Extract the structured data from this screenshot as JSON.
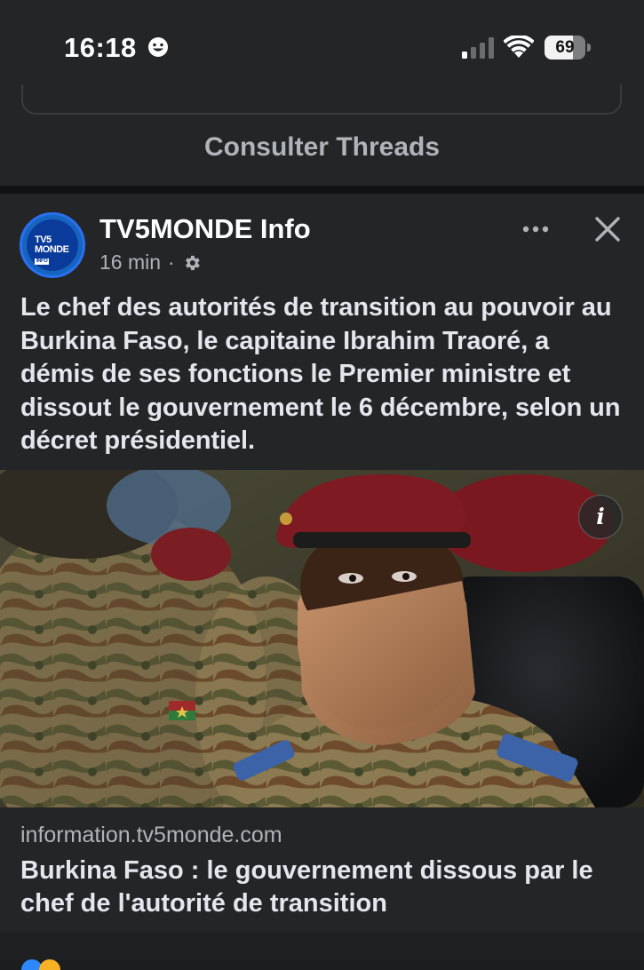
{
  "status_bar": {
    "time": "16:18",
    "battery_percent": "69",
    "battery_level": 0.69
  },
  "threads": {
    "link_label": "Consulter Threads"
  },
  "post": {
    "page_name": "TV5MONDE Info",
    "timestamp": "16 min",
    "separator": "·",
    "avatar_logo_line1": "TV5",
    "avatar_logo_line2": "MONDE",
    "avatar_logo_tag": "INFO",
    "text": "Le chef des autorités de transition au pouvoir au Burkina Faso, le capitaine Ibrahim Traoré, a démis de ses fonctions le Premier ministre et dissout le gouvernement le 6 décembre, selon un décret présidentiel.",
    "link": {
      "domain": "information.tv5monde.com",
      "title": "Burkina Faso : le gouvernement dissous par le chef de l'autorité de transition"
    },
    "info_icon_label": "i"
  },
  "icons": {
    "smiley": "smiley-icon",
    "signal": "cellular-signal-icon",
    "wifi": "wifi-icon",
    "battery": "battery-icon",
    "more": "more-horizontal-icon",
    "close": "close-icon",
    "gear": "gear-icon",
    "info": "info-icon"
  },
  "colors": {
    "background": "#242527",
    "text": "#e4e6eb",
    "muted": "#b0b3b8",
    "avatar_blue": "#1565c0"
  }
}
